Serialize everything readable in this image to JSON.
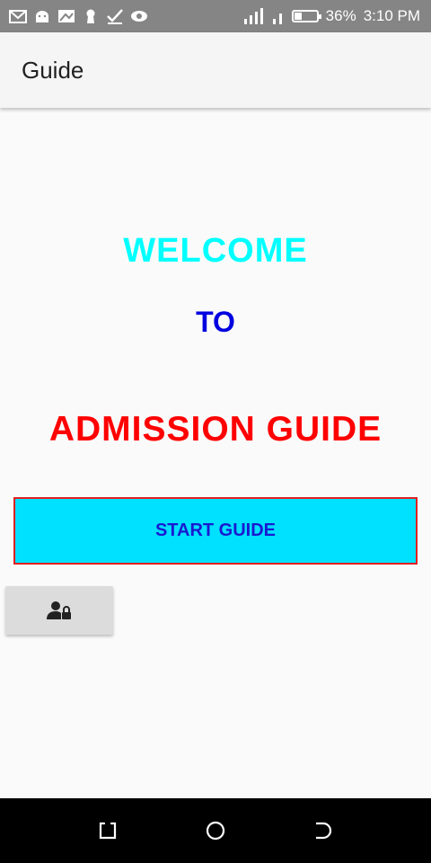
{
  "status_bar": {
    "battery": "36%",
    "battery_level": 0.36,
    "time": "3:10 PM",
    "left_icons": [
      "gmail-icon",
      "android-icon",
      "gallery-icon",
      "keyhole-icon",
      "checkmark-icon",
      "eye-icon"
    ],
    "right_icons": [
      "signal-icon",
      "signal-icon",
      "battery-icon"
    ]
  },
  "app_bar": {
    "title": "Guide"
  },
  "main": {
    "welcome": "WELCOME",
    "to": "TO",
    "admission": "ADMISSION GUIDE",
    "start_button": "START GUIDE",
    "admin_button_icon": "user-lock-icon"
  },
  "nav_bar": {
    "items": [
      {
        "icon": "recent-apps-icon"
      },
      {
        "icon": "home-icon"
      },
      {
        "icon": "back-icon"
      }
    ]
  },
  "colors": {
    "welcome": "#00ffff",
    "to": "#0000e0",
    "admission": "#ff0000",
    "start_button_bg": "#00e0ff",
    "start_button_border": "#e02020"
  }
}
